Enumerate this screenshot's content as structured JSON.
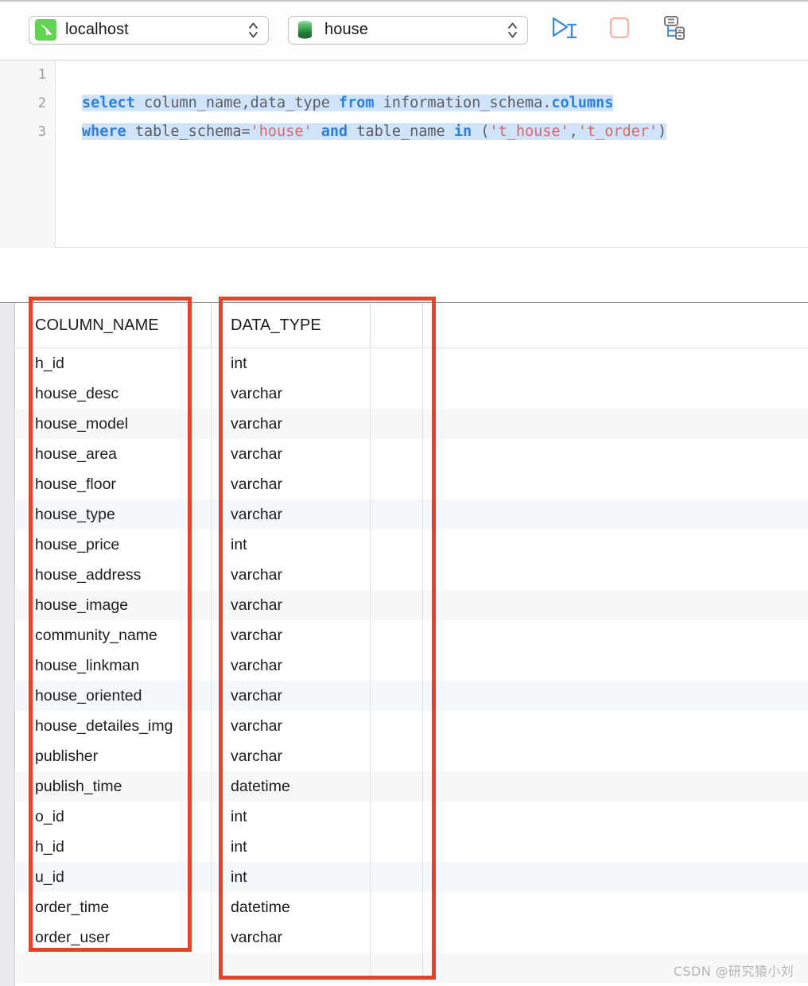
{
  "toolbar": {
    "connection": {
      "icon": "mysql-dolphin-icon",
      "value": "localhost",
      "stepper_icon": "updown-chevron-icon",
      "accent": "#63d353"
    },
    "database": {
      "icon": "database-cylinder-icon",
      "value": "house",
      "stepper_icon": "updown-chevron-icon",
      "accent": "#4caf50"
    },
    "buttons": [
      {
        "name": "run-query-button",
        "icon": "play-cursor-icon",
        "color": "#3f8ae0"
      },
      {
        "name": "stop-query-button",
        "icon": "stop-square-icon",
        "color": "#f4b6ac"
      },
      {
        "name": "explain-plan-button",
        "icon": "query-plan-tree-icon",
        "color": "#3f8ae0"
      }
    ]
  },
  "editor": {
    "line_numbers": [
      "1",
      "2",
      "3"
    ],
    "lines": [
      {
        "tokens": []
      },
      {
        "tokens": [
          {
            "t": "select",
            "c": "kw"
          },
          {
            "t": " ",
            "c": "pn"
          },
          {
            "t": "column_name,data_type",
            "c": "id"
          },
          {
            "t": " ",
            "c": "pn"
          },
          {
            "t": "from",
            "c": "kw"
          },
          {
            "t": " ",
            "c": "pn"
          },
          {
            "t": "information_schema.",
            "c": "id"
          },
          {
            "t": "columns",
            "c": "kw"
          }
        ]
      },
      {
        "tokens": [
          {
            "t": "where",
            "c": "kw"
          },
          {
            "t": " ",
            "c": "pn"
          },
          {
            "t": "table_schema=",
            "c": "id"
          },
          {
            "t": "'house'",
            "c": "str"
          },
          {
            "t": " ",
            "c": "pn"
          },
          {
            "t": "and",
            "c": "kw"
          },
          {
            "t": " ",
            "c": "pn"
          },
          {
            "t": "table_name",
            "c": "id"
          },
          {
            "t": " ",
            "c": "pn"
          },
          {
            "t": "in",
            "c": "kw"
          },
          {
            "t": " (",
            "c": "pn"
          },
          {
            "t": "'t_house'",
            "c": "str"
          },
          {
            "t": ",",
            "c": "pn"
          },
          {
            "t": "'t_order'",
            "c": "str"
          },
          {
            "t": ")",
            "c": "pn"
          }
        ]
      }
    ],
    "selection_color": "#cfe3fb"
  },
  "results": {
    "headers": [
      "COLUMN_NAME",
      "DATA_TYPE"
    ],
    "rows": [
      {
        "column_name": "h_id",
        "data_type": "int",
        "band": ""
      },
      {
        "column_name": "house_desc",
        "data_type": "varchar",
        "band": ""
      },
      {
        "column_name": "house_model",
        "data_type": "varchar",
        "band": "grayband"
      },
      {
        "column_name": "house_area",
        "data_type": "varchar",
        "band": ""
      },
      {
        "column_name": "house_floor",
        "data_type": "varchar",
        "band": ""
      },
      {
        "column_name": "house_type",
        "data_type": "varchar",
        "band": "blueband"
      },
      {
        "column_name": "house_price",
        "data_type": "int",
        "band": ""
      },
      {
        "column_name": "house_address",
        "data_type": "varchar",
        "band": ""
      },
      {
        "column_name": "house_image",
        "data_type": "varchar",
        "band": "grayband"
      },
      {
        "column_name": "community_name",
        "data_type": "varchar",
        "band": ""
      },
      {
        "column_name": "house_linkman",
        "data_type": "varchar",
        "band": ""
      },
      {
        "column_name": "house_oriented",
        "data_type": "varchar",
        "band": "blueband"
      },
      {
        "column_name": "house_detailes_img",
        "data_type": "varchar",
        "band": ""
      },
      {
        "column_name": "publisher",
        "data_type": "varchar",
        "band": ""
      },
      {
        "column_name": "publish_time",
        "data_type": "datetime",
        "band": "grayband"
      },
      {
        "column_name": "o_id",
        "data_type": "int",
        "band": ""
      },
      {
        "column_name": "h_id",
        "data_type": "int",
        "band": ""
      },
      {
        "column_name": "u_id",
        "data_type": "int",
        "band": "blueband"
      },
      {
        "column_name": "order_time",
        "data_type": "datetime",
        "band": ""
      },
      {
        "column_name": "order_user",
        "data_type": "varchar",
        "band": ""
      },
      {
        "column_name": "",
        "data_type": "",
        "band": "grayband"
      }
    ]
  },
  "annotations": {
    "boxes": [
      {
        "name": "column-name-highlight-box",
        "color": "#e8412a"
      },
      {
        "name": "data-type-highlight-box",
        "color": "#e8412a"
      }
    ]
  },
  "watermark": {
    "text": "CSDN @研究猿小刘"
  }
}
